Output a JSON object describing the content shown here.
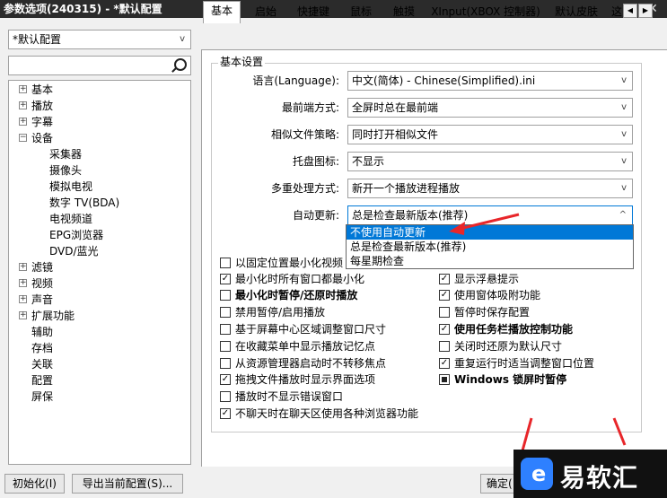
{
  "window": {
    "title": "参数选项(240315) - *默认配置",
    "close": "✕",
    "pin": "⊤"
  },
  "profile": {
    "value": "*默认配置"
  },
  "tree": {
    "items": [
      {
        "label": "基本",
        "expand": "+"
      },
      {
        "label": "播放",
        "expand": "+"
      },
      {
        "label": "字幕",
        "expand": "+"
      },
      {
        "label": "设备",
        "expand": "−"
      },
      {
        "label": "采集器"
      },
      {
        "label": "摄像头"
      },
      {
        "label": "模拟电视"
      },
      {
        "label": "数字 TV(BDA)"
      },
      {
        "label": "电视频道"
      },
      {
        "label": "EPG浏览器"
      },
      {
        "label": "DVD/蓝光"
      },
      {
        "label": "滤镜",
        "expand": "+"
      },
      {
        "label": "视频",
        "expand": "+"
      },
      {
        "label": "声音",
        "expand": "+"
      },
      {
        "label": "扩展功能",
        "expand": "+"
      },
      {
        "label": "辅助"
      },
      {
        "label": "存档"
      },
      {
        "label": "关联"
      },
      {
        "label": "配置"
      },
      {
        "label": "屏保"
      }
    ]
  },
  "tabs": [
    "基本",
    "启始",
    "快捷键",
    "鼠标",
    "触摸",
    "XInput(XBOX 控制器)",
    "默认皮肤",
    "这"
  ],
  "tab_scroll": {
    "left": "◀",
    "right": "▶"
  },
  "group": {
    "title": "基本设置"
  },
  "settings": {
    "language": {
      "label": "语言(Language):",
      "value": "中文(简体) - Chinese(Simplified).ini"
    },
    "topmost": {
      "label": "最前端方式:",
      "value": "全屏时总在最前端"
    },
    "similar": {
      "label": "相似文件策略:",
      "value": "同时打开相似文件"
    },
    "tray": {
      "label": "托盘图标:",
      "value": "不显示"
    },
    "multi": {
      "label": "多重处理方式:",
      "value": "新开一个播放进程播放"
    },
    "update": {
      "label": "自动更新:",
      "value": "总是检查最新版本(推荐)"
    }
  },
  "dropdown": {
    "arrow_down": "v",
    "arrow_up": "^",
    "options": [
      "不使用自动更新",
      "总是检查最新版本(推荐)",
      "每星期检查"
    ]
  },
  "checkboxes_left": [
    {
      "label": "以固定位置最小化视频",
      "checked": false
    },
    {
      "label": "最小化时所有窗口都最小化",
      "checked": true
    },
    {
      "label": "最小化时暂停/还原时播放",
      "checked": false,
      "bold": true
    },
    {
      "label": "禁用暂停/启用播放",
      "checked": false
    },
    {
      "label": "基于屏幕中心区域调整窗口尺寸",
      "checked": false
    },
    {
      "label": "在收藏菜单中显示播放记忆点",
      "checked": false
    },
    {
      "label": "从资源管理器启动时不转移焦点",
      "checked": false
    },
    {
      "label": "拖拽文件播放时显示界面选项",
      "checked": true
    },
    {
      "label": "播放时不显示错误窗口",
      "checked": false
    },
    {
      "label": "不聊天时在聊天区使用各种浏览器功能",
      "checked": true
    }
  ],
  "checkboxes_right": [
    {
      "label": "显示浮悬提示",
      "checked": true
    },
    {
      "label": "使用窗体吸附功能",
      "checked": true
    },
    {
      "label": "暂停时保存配置",
      "checked": false
    },
    {
      "label": "使用任务栏播放控制功能",
      "checked": true,
      "bold": true
    },
    {
      "label": "关闭时还原为默认尺寸",
      "checked": false
    },
    {
      "label": "重复运行时适当调整窗口位置",
      "checked": true
    },
    {
      "label": "Windows 锁屏时暂停",
      "checked": "partial",
      "bold": true
    }
  ],
  "check_mark": "✓",
  "buttons": {
    "init": "初始化(I)",
    "export": "导出当前配置(S)...",
    "ok": "确定("
  },
  "watermark": {
    "logo_letter": "e",
    "text": "易软汇"
  },
  "colors": {
    "accent": "#0078d7",
    "annotation": "#e8262a",
    "titlebar": "#2b2b2b"
  }
}
